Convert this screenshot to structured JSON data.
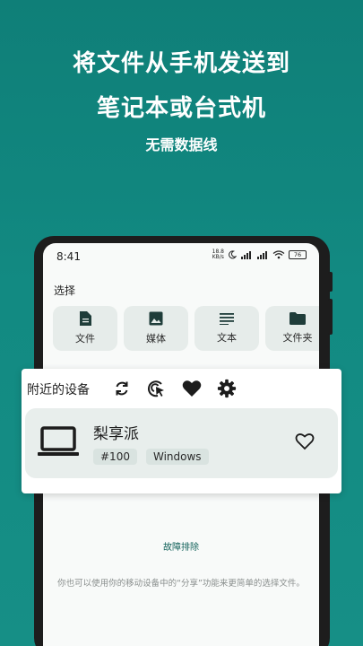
{
  "promo": {
    "line1": "将文件从手机发送到",
    "line2": "笔记本或台式机",
    "subtitle": "无需数据线"
  },
  "statusbar": {
    "time": "8:41",
    "net_speed_value": "18.8",
    "net_speed_unit": "KB/s",
    "battery": "76"
  },
  "select": {
    "label": "选择",
    "items": [
      {
        "label": "文件",
        "icon": "file-icon"
      },
      {
        "label": "媒体",
        "icon": "image-icon"
      },
      {
        "label": "文本",
        "icon": "text-lines-icon"
      },
      {
        "label": "文件夹",
        "icon": "folder-icon"
      }
    ]
  },
  "nearby": {
    "title": "附近的设备",
    "device": {
      "name": "梨享派",
      "tag_id": "#100",
      "tag_os": "Windows"
    }
  },
  "troubleshoot": "故障排除",
  "hint": "你也可以使用你的移动设备中的“分享”功能来更简单的选择文件。",
  "colors": {
    "background": "#128a82",
    "accent": "#13625b",
    "card": "#e6ecea"
  }
}
